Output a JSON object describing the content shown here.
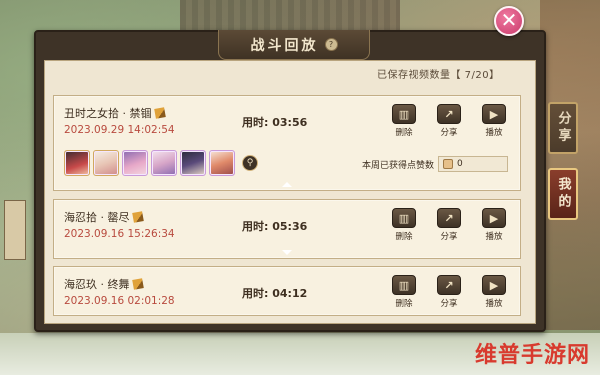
{
  "panel": {
    "title": "战斗回放",
    "title_badge": "?",
    "close_label": "✕",
    "saved_count": "已保存视频数量【 7/20】"
  },
  "side_tabs": {
    "share": "分享",
    "mine": "我的"
  },
  "records": [
    {
      "title": "丑时之女拾 · 禁锢",
      "date": "2023.09.29 14:02:54",
      "duration_label": "用时:",
      "duration": "03:56",
      "likes_label": "本周已获得点赞数",
      "likes": "0",
      "expanded": true
    },
    {
      "title": "海忍拾 · 罄尽",
      "date": "2023.09.16 15:26:34",
      "duration_label": "用时:",
      "duration": "05:36",
      "expanded": false
    },
    {
      "title": "海忍玖 · 终舞",
      "date": "2023.09.16 02:01:28",
      "duration_label": "用时:",
      "duration": "04:12",
      "expanded": false
    }
  ],
  "actions": {
    "delete": "删除",
    "share": "分享",
    "play": "播放"
  },
  "icons": {
    "delete": "▥",
    "share": "↗",
    "play": "▶",
    "magnify": "⚲"
  },
  "watermark": "维普手游网",
  "colors": {
    "panel_bg": "#efe6d2",
    "date_red": "#b84a3e",
    "close_pink": "#c93a6c",
    "watermark_red": "#d83a2e"
  }
}
